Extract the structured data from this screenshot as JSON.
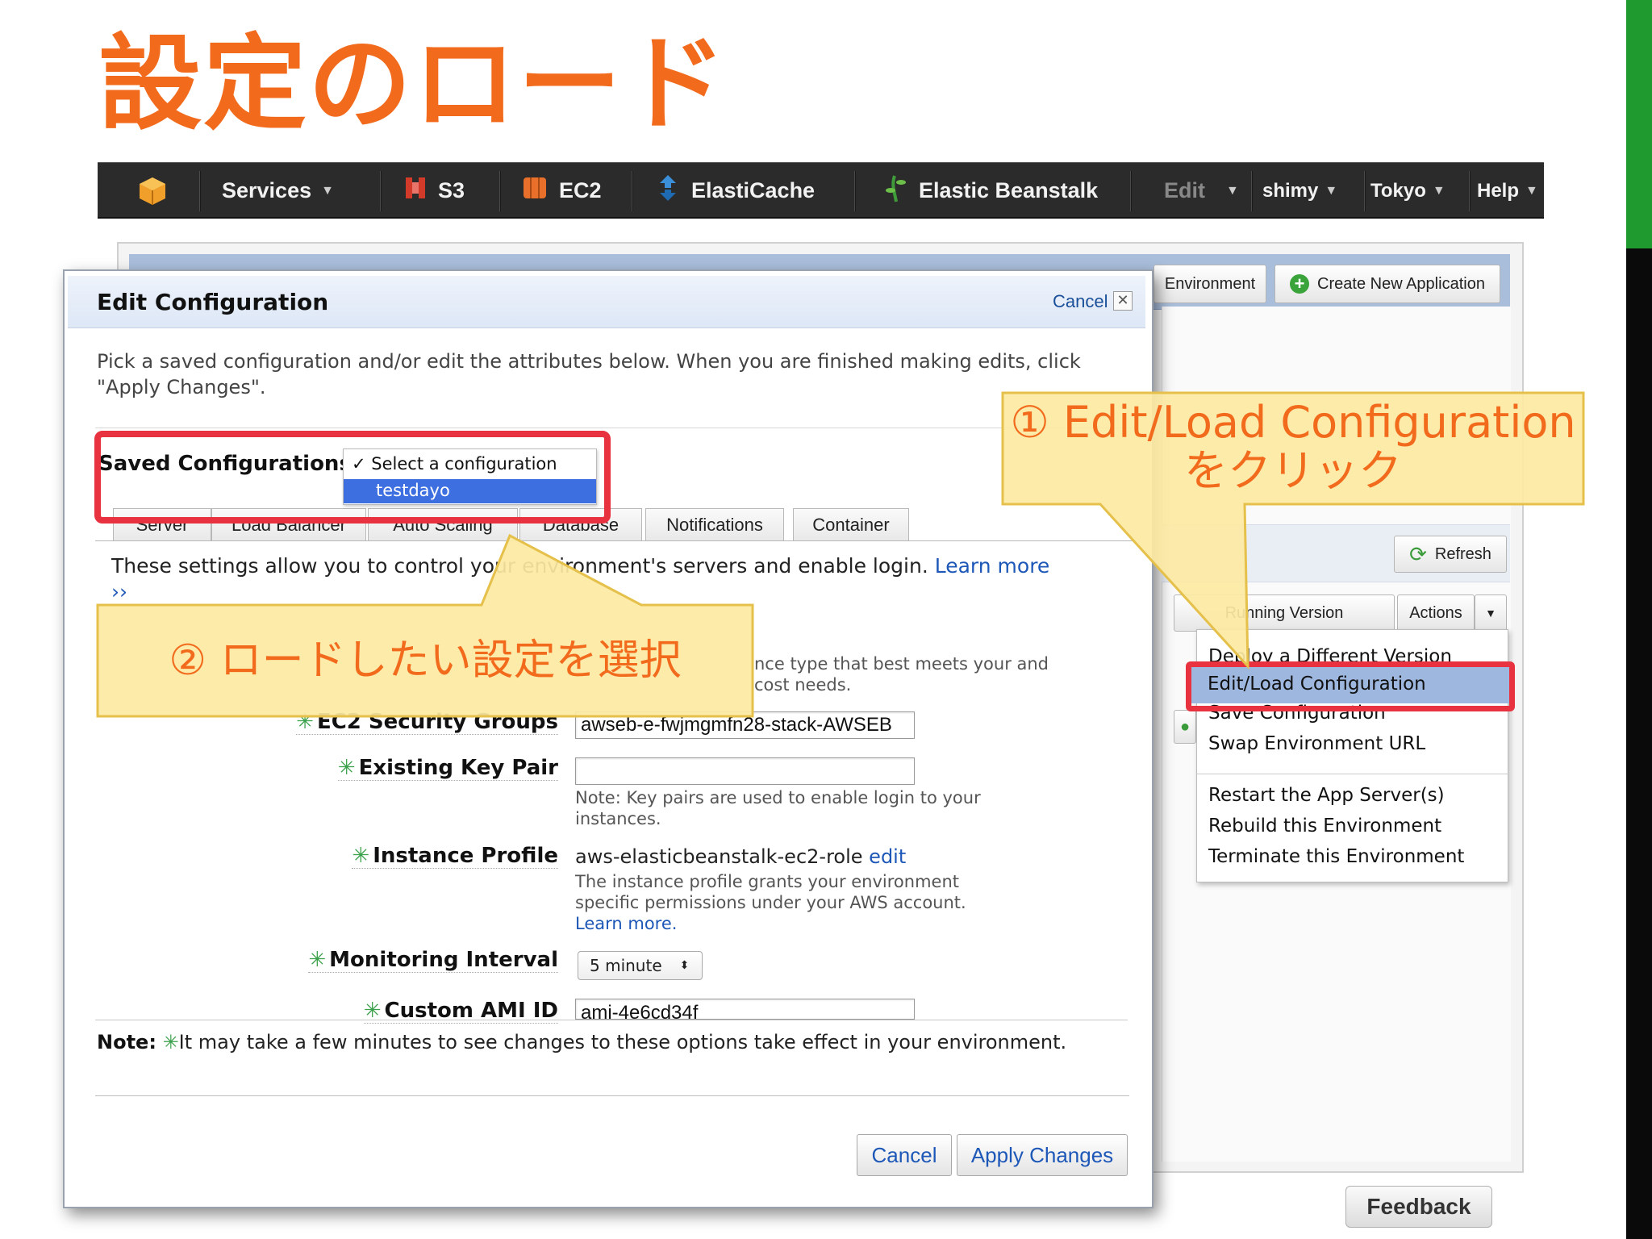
{
  "slide": {
    "title": "設定のロード"
  },
  "nav": {
    "services": "Services",
    "s3": "S3",
    "ec2": "EC2",
    "elasticache": "ElastiCache",
    "beanstalk": "Elastic Beanstalk",
    "edit": "Edit",
    "user": "shimy",
    "region": "Tokyo",
    "help": "Help"
  },
  "console": {
    "environment_btn": "Environment",
    "create_app_btn": "Create New Application",
    "refresh_btn": "Refresh",
    "running_version_btn": "Running Version",
    "actions_btn": "Actions",
    "feedback_btn": "Feedback"
  },
  "actions_menu": {
    "items": [
      "Deploy a Different Version",
      "Edit/Load Configuration",
      "Save Configuration",
      "Swap Environment URL",
      "Restart the App Server(s)",
      "Rebuild this Environment",
      "Terminate this Environment"
    ]
  },
  "dialog": {
    "title": "Edit Configuration",
    "cancel_link": "Cancel",
    "intro": "Pick a saved configuration and/or edit the attributes below. When you are finished making edits, click \"Apply Changes\".",
    "saved_label": "Saved Configurations:",
    "dropdown_options": [
      "Select a configuration",
      "testdayo"
    ],
    "tabs": [
      "Server",
      "Load Balancer",
      "Auto Scaling",
      "Database",
      "Notifications",
      "Container"
    ],
    "settings_text": "These settings allow you to control your environment's servers and enable login.",
    "learn_more": "Learn more",
    "learn_more_arrow": "››",
    "hint_text": "nce type that best meets your and cost needs.",
    "fields": {
      "security_groups_label": "EC2 Security Groups",
      "security_groups_value": "awseb-e-fwjmgmfn28-stack-AWSEB",
      "key_pair_label": "Existing Key Pair",
      "key_pair_value": "",
      "key_pair_note": "Note: Key pairs are used to enable login to your instances.",
      "instance_profile_label": "Instance Profile",
      "instance_profile_value": "aws-elasticbeanstalk-ec2-role",
      "instance_profile_edit": "edit",
      "instance_profile_note": "The instance profile grants your environment specific permissions under your AWS account.",
      "instance_profile_learn": "Learn more.",
      "monitoring_label": "Monitoring Interval",
      "monitoring_value": "5 minute",
      "ami_label": "Custom AMI ID",
      "ami_value": "ami-4e6cd34f"
    },
    "note_label": "Note:",
    "note_text": "It may take a few minutes to see changes to these options take effect in your environment.",
    "cancel_btn": "Cancel",
    "apply_btn": "Apply Changes"
  },
  "callouts": {
    "step1_line1": "① Edit/Load Configuration",
    "step1_line2": "をクリック",
    "step2": "② ロードしたい設定を選択"
  },
  "colors": {
    "title_orange": "#f26b1d",
    "highlight_red": "#e8323f",
    "callout_fill": "#fde9a3",
    "link_blue": "#1d57b7"
  }
}
